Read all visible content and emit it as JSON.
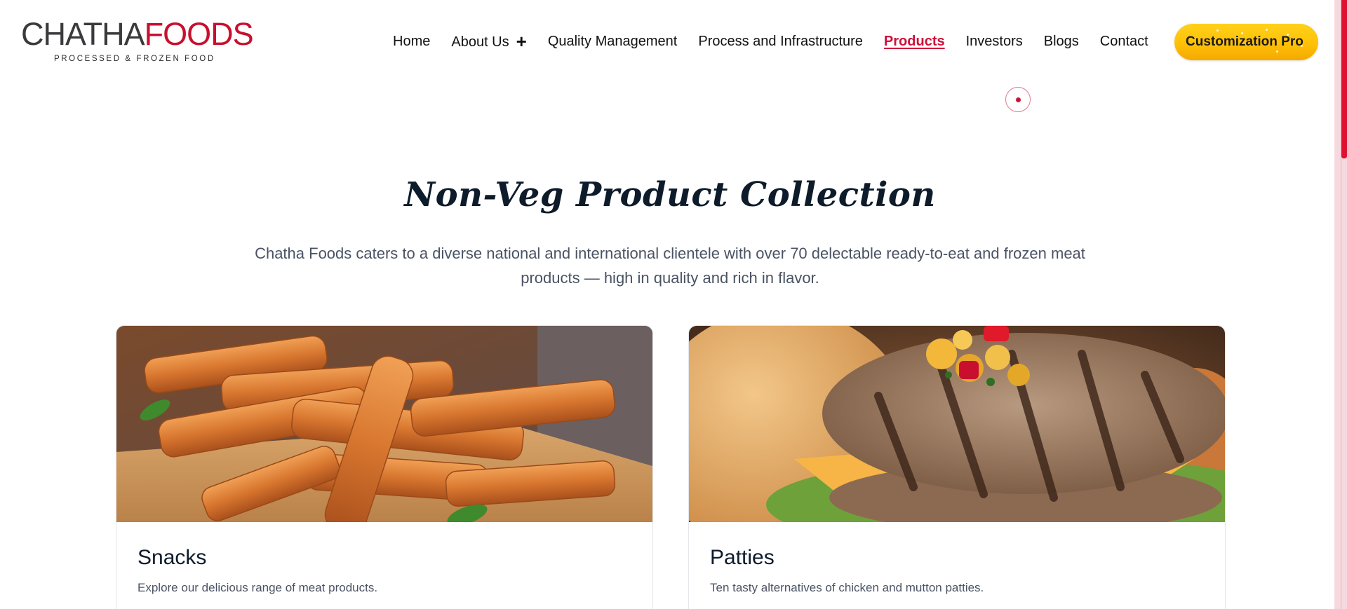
{
  "brand": {
    "logo_part1": "CHATHA",
    "logo_part2": "FOODS",
    "tagline": "PROCESSED & FROZEN FOOD"
  },
  "nav": {
    "items": [
      {
        "label": "Home"
      },
      {
        "label": "About Us"
      },
      {
        "label": "Quality Management"
      },
      {
        "label": "Process and Infrastructure"
      },
      {
        "label": "Products"
      },
      {
        "label": "Investors"
      },
      {
        "label": "Blogs"
      },
      {
        "label": "Contact"
      }
    ],
    "active": "Products",
    "cta_label": "Customization Pro"
  },
  "section": {
    "title": "Non-Veg Product Collection",
    "description": "Chatha Foods caters to a diverse national and international clientele with over 70 delectable ready-to-eat and frozen meat products — high in quality and rich in flavor."
  },
  "cards": [
    {
      "title": "Snacks",
      "text": "Explore our delicious range of meat products."
    },
    {
      "title": "Patties",
      "text": "Ten tasty alternatives of chicken and mutton patties."
    }
  ],
  "colors": {
    "brand_red": "#c8102e",
    "accent_yellow": "#ffc107",
    "heading_navy": "#0d1b2a"
  },
  "icons": {
    "about_expand": "plus-icon",
    "scroll_indicator": "dot-icon"
  }
}
